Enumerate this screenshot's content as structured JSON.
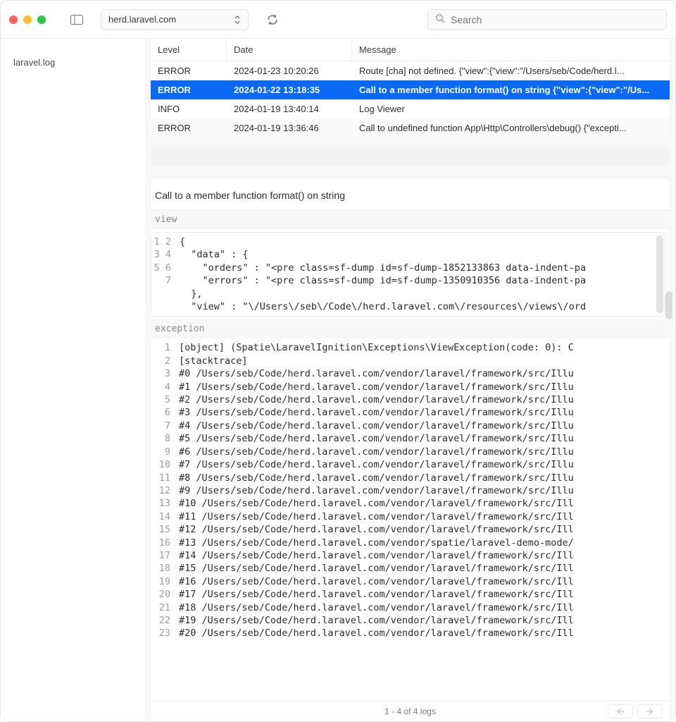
{
  "titlebar": {
    "site": "herd.laravel.com",
    "search_placeholder": "Search"
  },
  "sidebar": {
    "items": [
      "laravel.log"
    ]
  },
  "columns": {
    "level": "Level",
    "date": "Date",
    "message": "Message"
  },
  "rows": [
    {
      "level": "ERROR",
      "date": "2024-01-23 10:20:26",
      "message": "Route [cha] not defined. {\"view\":{\"view\":\"/Users/seb/Code/herd.l...",
      "selected": false
    },
    {
      "level": "ERROR",
      "date": "2024-01-22 13:18:35",
      "message": "Call to a member function format() on string {\"view\":{\"view\":\"/Us...",
      "selected": true
    },
    {
      "level": "INFO",
      "date": "2024-01-19 13:40:14",
      "message": "Log Viewer",
      "selected": false
    },
    {
      "level": "ERROR",
      "date": "2024-01-19 13:36:46",
      "message": "Call to undefined function App\\Http\\Controllers\\debug() {\"excepti...",
      "selected": false
    }
  ],
  "detail": {
    "title": "Call to a member function format() on string",
    "sections": {
      "view_label": "view",
      "view_lines": [
        "{",
        "  \"data\" : {",
        "    \"orders\" : \"<pre class=sf-dump id=sf-dump-1852133863 data-indent-pa",
        "    \"errors\" : \"<pre class=sf-dump id=sf-dump-1350910356 data-indent-pa",
        "  },",
        "  \"view\" : \"\\/Users\\/seb\\/Code\\/herd.laravel.com\\/resources\\/views\\/ord",
        ""
      ],
      "exception_label": "exception",
      "exception_lines": [
        "[object] (Spatie\\LaravelIgnition\\Exceptions\\ViewException(code: 0): C",
        "[stacktrace]",
        "#0 /Users/seb/Code/herd.laravel.com/vendor/laravel/framework/src/Illu",
        "#1 /Users/seb/Code/herd.laravel.com/vendor/laravel/framework/src/Illu",
        "#2 /Users/seb/Code/herd.laravel.com/vendor/laravel/framework/src/Illu",
        "#3 /Users/seb/Code/herd.laravel.com/vendor/laravel/framework/src/Illu",
        "#4 /Users/seb/Code/herd.laravel.com/vendor/laravel/framework/src/Illu",
        "#5 /Users/seb/Code/herd.laravel.com/vendor/laravel/framework/src/Illu",
        "#6 /Users/seb/Code/herd.laravel.com/vendor/laravel/framework/src/Illu",
        "#7 /Users/seb/Code/herd.laravel.com/vendor/laravel/framework/src/Illu",
        "#8 /Users/seb/Code/herd.laravel.com/vendor/laravel/framework/src/Illu",
        "#9 /Users/seb/Code/herd.laravel.com/vendor/laravel/framework/src/Illu",
        "#10 /Users/seb/Code/herd.laravel.com/vendor/laravel/framework/src/Ill",
        "#11 /Users/seb/Code/herd.laravel.com/vendor/laravel/framework/src/Ill",
        "#12 /Users/seb/Code/herd.laravel.com/vendor/laravel/framework/src/Ill",
        "#13 /Users/seb/Code/herd.laravel.com/vendor/spatie/laravel-demo-mode/",
        "#14 /Users/seb/Code/herd.laravel.com/vendor/laravel/framework/src/Ill",
        "#15 /Users/seb/Code/herd.laravel.com/vendor/laravel/framework/src/Ill",
        "#16 /Users/seb/Code/herd.laravel.com/vendor/laravel/framework/src/Ill",
        "#17 /Users/seb/Code/herd.laravel.com/vendor/laravel/framework/src/Ill",
        "#18 /Users/seb/Code/herd.laravel.com/vendor/laravel/framework/src/Ill",
        "#19 /Users/seb/Code/herd.laravel.com/vendor/laravel/framework/src/Ill",
        "#20 /Users/seb/Code/herd.laravel.com/vendor/laravel/framework/src/Ill"
      ]
    }
  },
  "footer": {
    "status": "1 - 4 of 4 logs"
  }
}
